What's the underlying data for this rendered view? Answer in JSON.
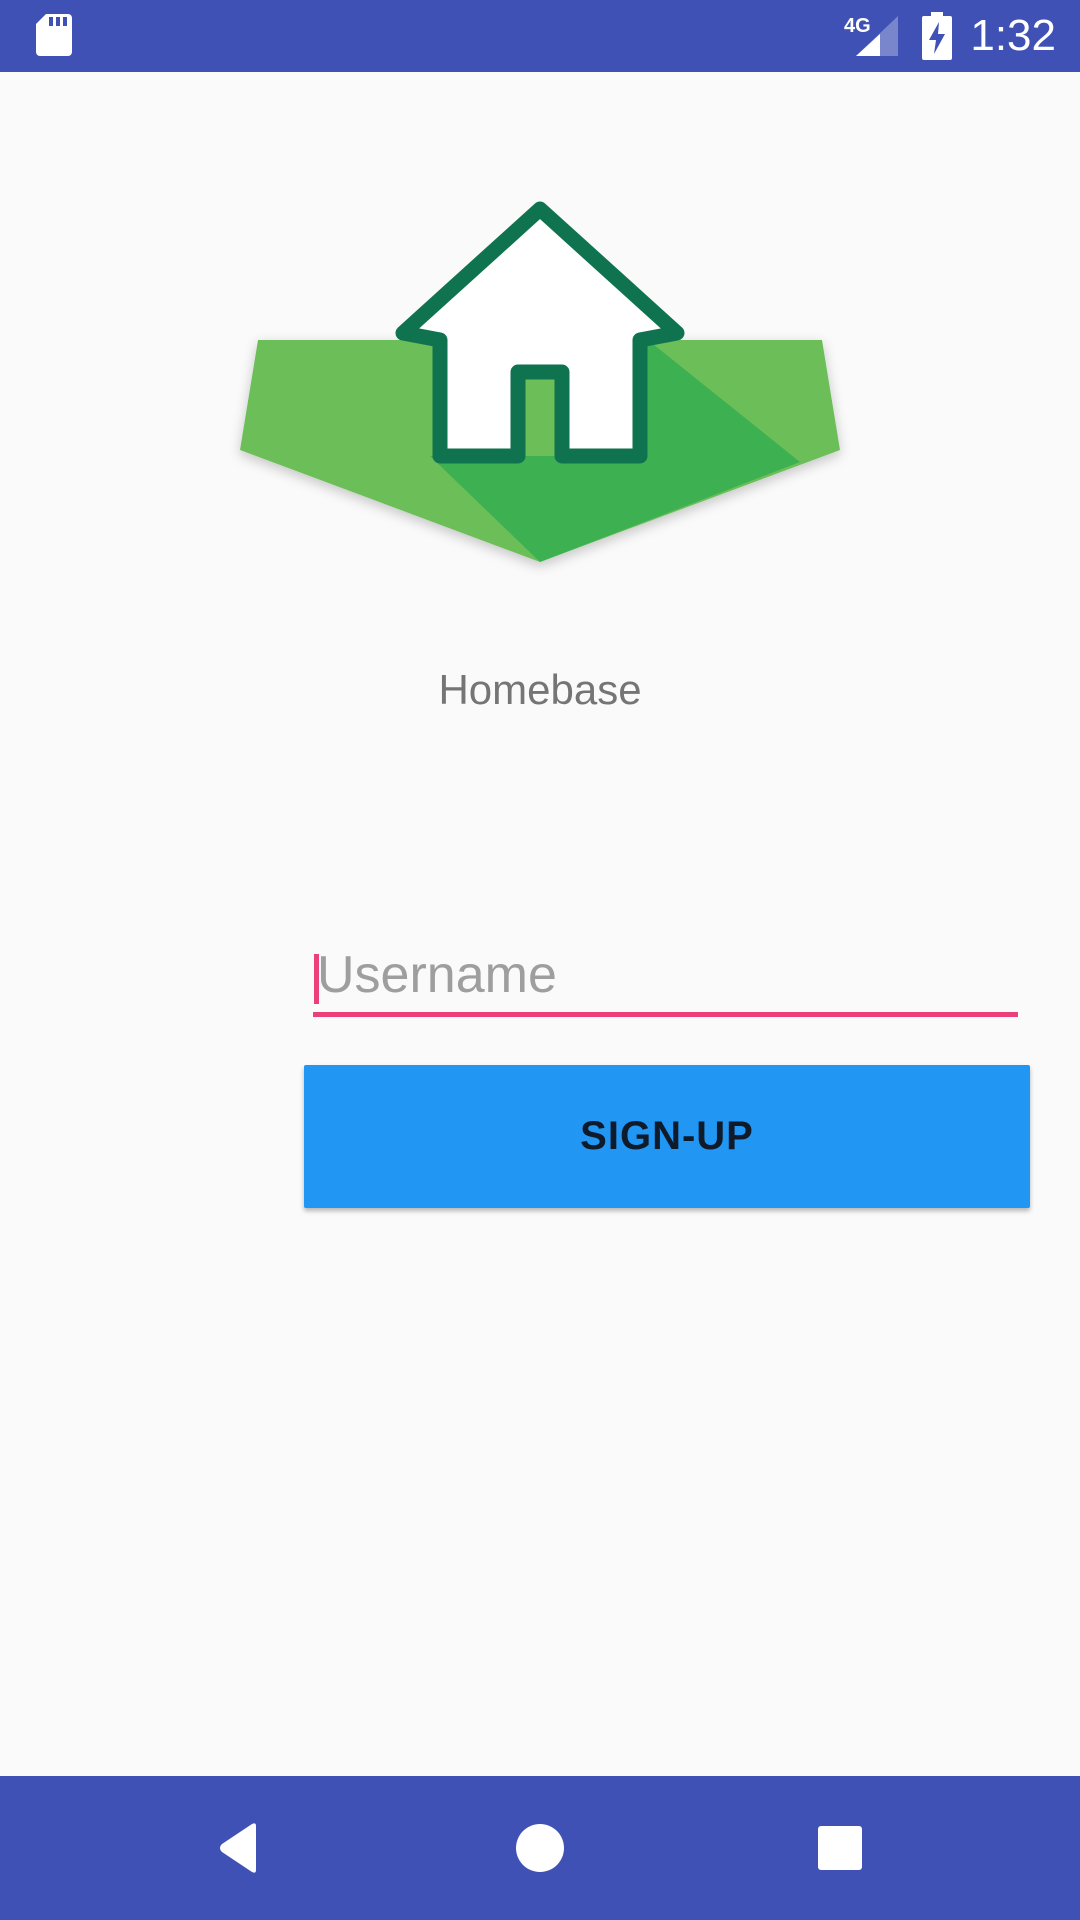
{
  "status_bar": {
    "time": "1:32",
    "network_label": "4G",
    "icons": [
      "sd-card-icon",
      "signal-icon",
      "battery-charging-icon"
    ]
  },
  "logo": {
    "icon": "house-logo-icon",
    "colors": {
      "light_green": "#6cbf58",
      "dark_green": "#3db152",
      "outline": "#107350",
      "house_fill": "#ffffff"
    }
  },
  "app_name": "Homebase",
  "form": {
    "username": {
      "placeholder": "Username",
      "value": ""
    },
    "signup_label": "SIGN-UP"
  },
  "nav_bar": {
    "icons": [
      "back-icon",
      "home-icon",
      "recents-icon"
    ]
  },
  "colors": {
    "primary": "#3f51b5",
    "accent": "#ec407a",
    "button": "#2196f3",
    "background": "#fafafa"
  }
}
